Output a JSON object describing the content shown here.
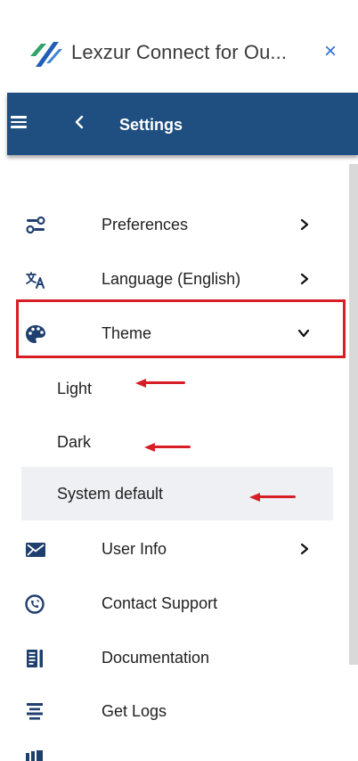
{
  "app": {
    "title": "Lexzur Connect for Ou...",
    "close_glyph": "×"
  },
  "header": {
    "title": "Settings"
  },
  "menu": {
    "preferences": {
      "label": "Preferences",
      "icon": "preferences-toggle-icon"
    },
    "language": {
      "label": "Language (English)",
      "icon": "translate-icon"
    },
    "theme": {
      "label": "Theme",
      "icon": "palette-icon",
      "expanded": true,
      "options": [
        {
          "label": "Light",
          "selected": false
        },
        {
          "label": "Dark",
          "selected": false
        },
        {
          "label": "System default",
          "selected": true
        }
      ]
    },
    "user_info": {
      "label": "User Info",
      "icon": "envelope-icon"
    },
    "contact_support": {
      "label": "Contact Support",
      "icon": "phone-support-icon"
    },
    "documentation": {
      "label": "Documentation",
      "icon": "document-icon"
    },
    "get_logs": {
      "label": "Get Logs",
      "icon": "logs-icon"
    }
  },
  "colors": {
    "header_bg": "#1f4e80",
    "highlight": "#d81e25",
    "selected_bg": "#eef0f3",
    "close": "#2f6fd6"
  }
}
